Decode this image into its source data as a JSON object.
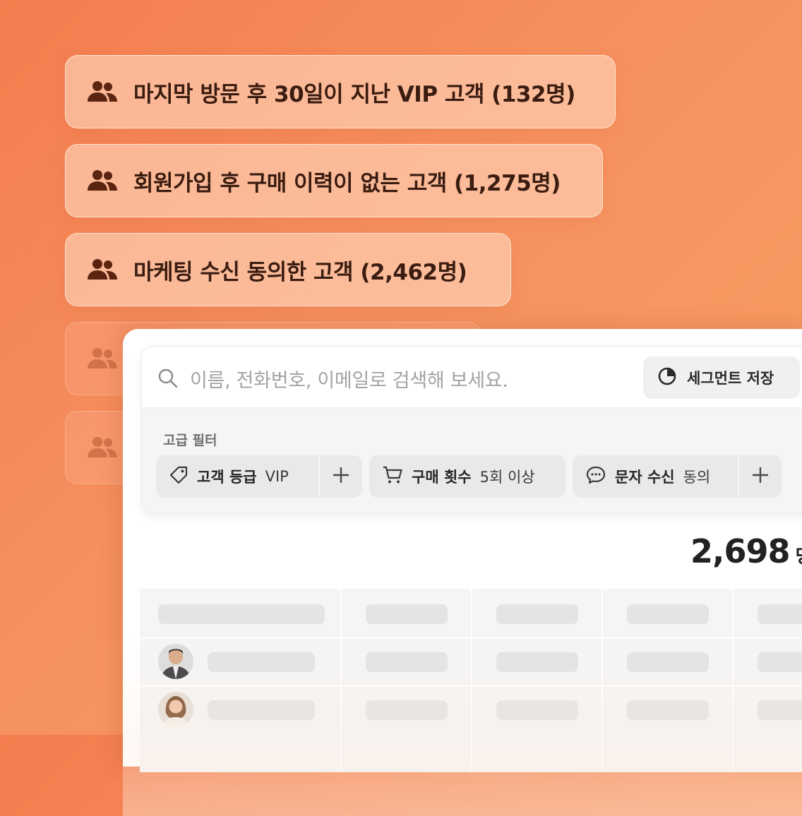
{
  "segments": [
    {
      "label": "마지막 방문 후 30일이 지난 VIP 고객 (132명)",
      "icon": "users-icon"
    },
    {
      "label": "회원가입 후 구매 이력이 없는 고객 (1,275명)",
      "icon": "users-icon"
    },
    {
      "label": "마케팅 수신 동의한 고객 (2,462명)",
      "icon": "users-icon"
    }
  ],
  "search": {
    "placeholder": "이름, 전화번호, 이메일로 검색해 보세요."
  },
  "save_segment": {
    "label": "세그먼트 저장",
    "icon": "pie-chart-icon"
  },
  "advanced_filter": {
    "title": "고급 필터",
    "filters": [
      {
        "key": "고객 등급",
        "value": "VIP",
        "icon": "tag-icon"
      },
      {
        "key": "구매 횟수",
        "value": "5회 이상",
        "icon": "cart-icon"
      },
      {
        "key": "문자 수신",
        "value": "동의",
        "icon": "chat-bubble-icon"
      }
    ]
  },
  "result": {
    "count": "2,698",
    "unit": "명"
  },
  "colors": {
    "bg_start": "#f37d4e",
    "bg_end": "#f9a063",
    "chip_text": "#3a1c10",
    "icon_brown": "#5a2410"
  }
}
